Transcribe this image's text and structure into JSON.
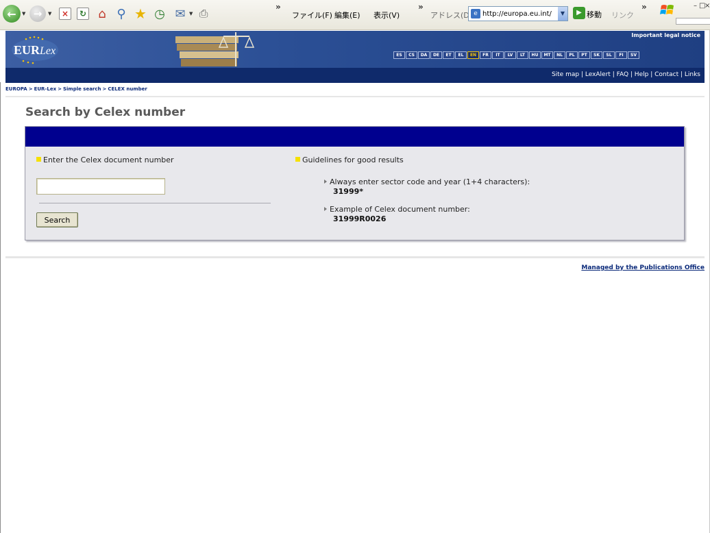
{
  "browser": {
    "menu": [
      "ファイル(F)",
      "編集(E)",
      "表示(V)"
    ],
    "address_label": "アドレス(D)",
    "address_url": "http://europa.eu.int/",
    "go_label": "移動",
    "links_label": "リンク",
    "overflow_glyph": "»"
  },
  "header": {
    "legal_notice": "Important legal notice",
    "languages": [
      "ES",
      "CS",
      "DA",
      "DE",
      "ET",
      "EL",
      "EN",
      "FR",
      "IT",
      "LV",
      "LT",
      "HU",
      "MT",
      "NL",
      "PL",
      "PT",
      "SK",
      "SL",
      "FI",
      "SV"
    ],
    "active_language": "EN",
    "top_links": [
      "Site map",
      "LexAlert",
      "FAQ",
      "Help",
      "Contact",
      "Links"
    ]
  },
  "breadcrumb": [
    "EUROPA",
    "EUR-Lex",
    "Simple search",
    "CELEX number"
  ],
  "page": {
    "title": "Search by Celex number",
    "left_section_title": "Enter the Celex document number",
    "input_value": "",
    "search_button": "Search",
    "right_section_title": "Guidelines for good results",
    "guidelines": [
      {
        "text": "Always enter sector code and year (1+4 characters):",
        "example": "31999*"
      },
      {
        "text": "Example of Celex document number:",
        "example": "31999R0026"
      }
    ]
  },
  "footer": {
    "managed": "Managed by the Publications Office"
  },
  "colors": {
    "header_blue": "#2b4f95",
    "panel_head": "#00008f",
    "accent_yellow": "#f5e000",
    "link_blue": "#0b2a7a"
  }
}
